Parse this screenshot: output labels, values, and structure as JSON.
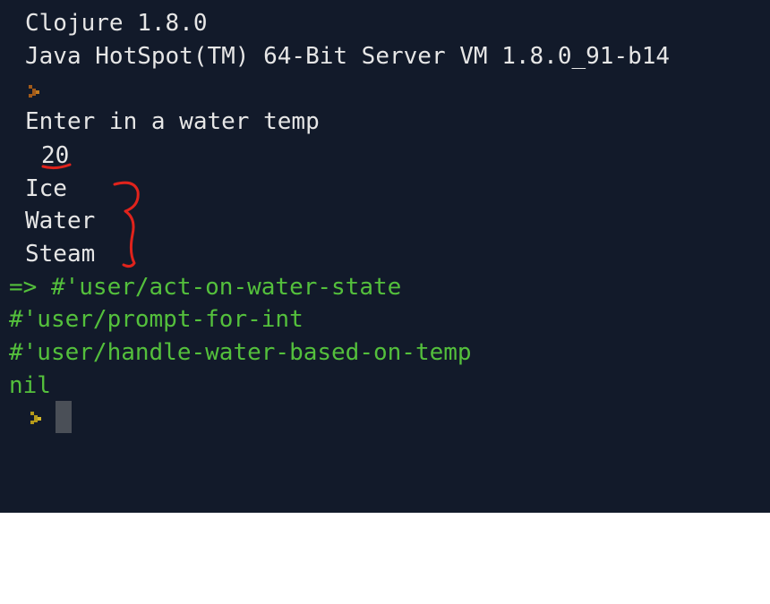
{
  "terminal": {
    "banner_clojure": "Clojure 1.8.0",
    "banner_jvm": "Java HotSpot(TM) 64-Bit Server VM 1.8.0_91-b14",
    "prompt_message": "Enter in a water temp",
    "user_input": "20",
    "output_lines": [
      "Ice",
      "Water",
      "Steam"
    ],
    "result_lines": [
      "=> #'user/act-on-water-state",
      "#'user/prompt-for-int",
      "#'user/handle-water-based-on-temp",
      "nil"
    ],
    "colors": {
      "background": "#121a2a",
      "text": "#e6e6e6",
      "result": "#54c03c",
      "prompt_glyph_first": "#a15a1a",
      "prompt_glyph_second": "#b59a1a",
      "annotation": "#e0231c"
    },
    "icons": {
      "prompt": "prompt-chevron-icon",
      "cursor": "block-cursor"
    }
  }
}
